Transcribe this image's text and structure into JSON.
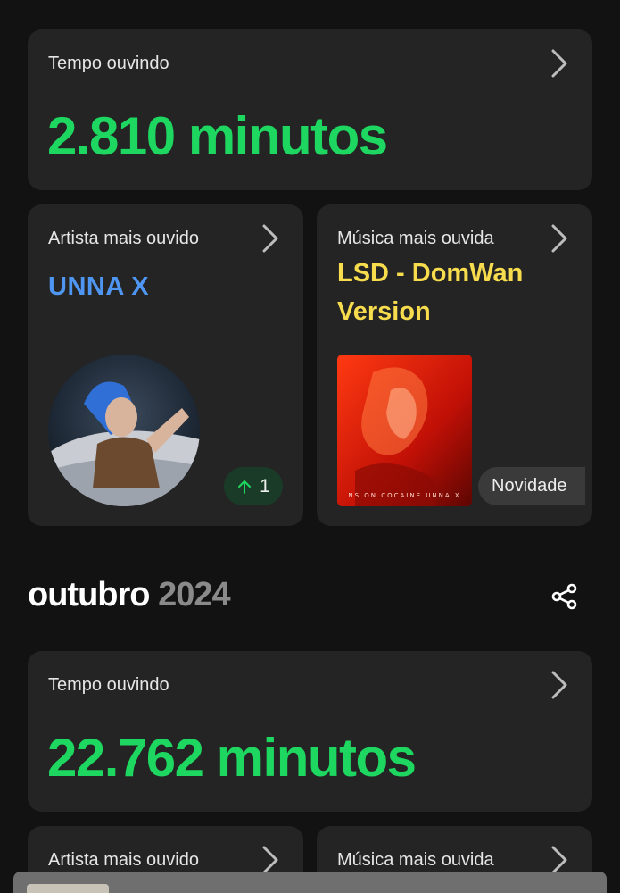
{
  "summary": {
    "time_card": {
      "label": "Tempo ouvindo",
      "value": "2.810 minutos"
    },
    "artist_card": {
      "label": "Artista mais ouvido",
      "name": "UNNA X",
      "rank_change": "1"
    },
    "song_card": {
      "label": "Música mais ouvida",
      "title": "LSD - DomWan Version",
      "badge": "Novidade",
      "cover_text": "NS ON COCAINE  UNNA X"
    }
  },
  "month_section": {
    "month": "outubro",
    "year": "2024",
    "time_card": {
      "label": "Tempo ouvindo",
      "value": "22.762 minutos"
    },
    "artist_card": {
      "label": "Artista mais ouvido"
    },
    "song_card": {
      "label": "Música mais ouvida"
    }
  },
  "icons": {
    "chevron": "chevron-right-icon",
    "share": "share-icon",
    "arrow_up": "arrow-up-icon"
  },
  "colors": {
    "background": "#121212",
    "card": "#242424",
    "accent_green": "#1ed760",
    "artist_blue": "#4f96f2",
    "song_yellow": "#f7dc4e",
    "year_gray": "#8a8a8a"
  }
}
